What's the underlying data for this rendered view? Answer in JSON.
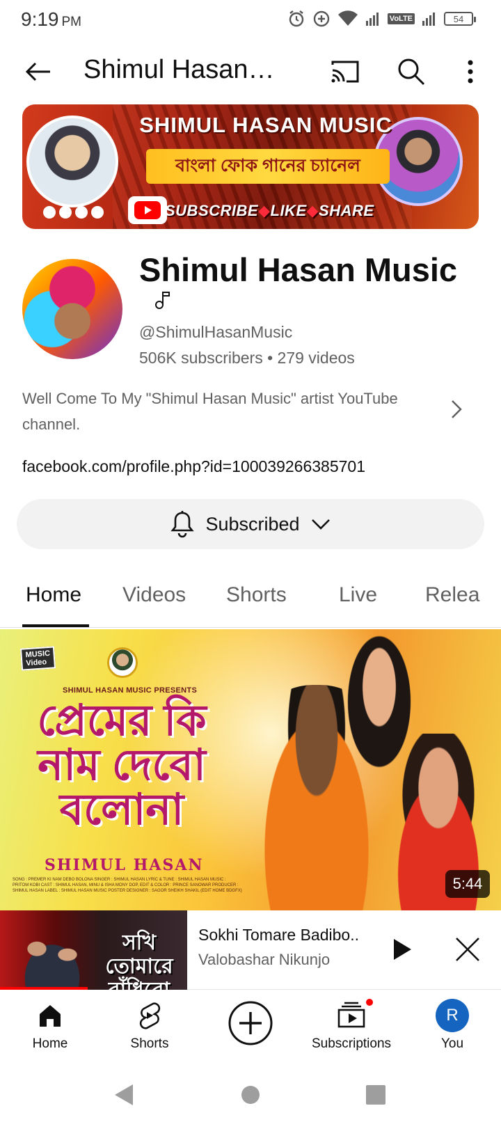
{
  "status_bar": {
    "time": "9:19",
    "ampm": "PM",
    "network_badge": "VoLTE",
    "battery_level": "54"
  },
  "top_bar": {
    "title": "Shimul Hasan…"
  },
  "banner": {
    "title": "SHIMUL HASAN MUSIC",
    "tagline": "বাংলা ফোক গানের চ্যানেল",
    "cta_subscribe": "SUBSCRIBE",
    "cta_like": "LIKE",
    "cta_share": "SHARE"
  },
  "channel": {
    "name": "Shimul Hasan Music",
    "handle": "@ShimulHasanMusic",
    "stats": "506K subscribers • 279 videos",
    "description": "Well Come To My \"Shimul Hasan Music\" artist YouTube channel.",
    "link": "facebook.com/profile.php?id=100039266385701"
  },
  "subscribe": {
    "label": "Subscribed"
  },
  "tabs": [
    {
      "label": "Home",
      "active": true
    },
    {
      "label": "Videos",
      "active": false
    },
    {
      "label": "Shorts",
      "active": false
    },
    {
      "label": "Live",
      "active": false
    },
    {
      "label": "Relea",
      "active": false
    }
  ],
  "featured_video": {
    "badge_line1": "MUSIC",
    "badge_line2": "Video",
    "presents": "SHIMUL HASAN MUSIC PRESENTS",
    "song_title": "প্রেমের কি নাম দেবো বলোনা",
    "artist": "SHIMUL HASAN",
    "credits": "SONG : PREMER KI NAM DEBO BOLONA SINGER : SHIMUL HASAN LYRIC & TUNE : SHIMUL HASAN MUSIC : PRITOM KOBI CAST : SHIMUL HASAN, MINU & ISHA MONY DOP, EDIT & COLOR : PRINCE SANOWAR PRODUCER : SHIMUL HASAN LABEL : SHIMUL HASAN MUSIC POSTER DESIGNER : SAGOR SHEIKH SHAKIL (EDIT HOME BDGFX)",
    "duration": "5:44"
  },
  "miniplayer": {
    "thumb_text": "সখি তোমারে বাঁধিবো",
    "title": "Sokhi Tomare Badibo..",
    "subtitle": "Valobashar Nikunjo",
    "progress": 0.47
  },
  "bottom_nav": {
    "home": "Home",
    "shorts": "Shorts",
    "subscriptions": "Subscriptions",
    "you": "You",
    "you_initial": "R"
  },
  "colors": {
    "brand_red": "#ff0000",
    "text_primary": "#0f0f0f",
    "text_secondary": "#606060",
    "subscribe_bg": "#f2f2f2",
    "avatar_blue": "#1565c0"
  },
  "icons": {
    "back": "arrow-left-icon",
    "cast": "cast-icon",
    "search": "search-icon",
    "more": "more-vert-icon",
    "bell": "bell-icon",
    "chevron": "chevron-down-icon",
    "note": "music-note-icon"
  }
}
